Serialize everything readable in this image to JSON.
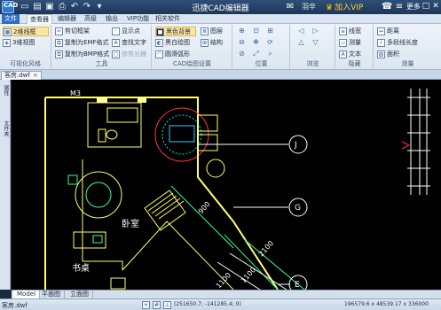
{
  "titlebar": {
    "app_icon_text": "CAD",
    "title": "迅捷CAD编辑器",
    "user_name": "羽辛",
    "vip_label": "加入VIP",
    "more_label": "更多",
    "quick_access": [
      "new-icon",
      "open-icon",
      "save-icon",
      "print-icon",
      "undo-icon",
      "redo-icon",
      "dropdown-icon"
    ]
  },
  "menubar": {
    "items": [
      "文件",
      "查看器",
      "编辑器",
      "高级",
      "输出",
      "VIP功能",
      "相关软件"
    ],
    "active_index": 1
  },
  "ribbon": {
    "visual_style": {
      "label": "可视化风格",
      "buttons": [
        "2维线框",
        "3维视图"
      ],
      "selected": 0
    },
    "tools": {
      "label": "工具",
      "buttons": [
        "剪切框架",
        "复制为EMF格式",
        "复制为BMP格式",
        "显示点",
        "查找文字",
        "修剪光栅"
      ]
    },
    "draw_settings": {
      "label": "CAD绘图设置",
      "buttons": [
        "黑色背景",
        "黑白绘图",
        "圆滑弧形",
        "图层",
        "结构"
      ],
      "selected": 0
    },
    "position": {
      "label": "位置"
    },
    "browse": {
      "label": "浏览"
    },
    "hide": {
      "label": "隐藏",
      "buttons": [
        "线宽",
        "测量",
        "文本"
      ]
    },
    "measure": {
      "label": "测量",
      "buttons": [
        "距离",
        "多段线长度",
        "面积"
      ]
    }
  },
  "document": {
    "tab_label": "客房.dwf"
  },
  "side_panel": {
    "tabs": [
      "属性",
      "文件夹"
    ]
  },
  "drawing": {
    "room_labels": [
      "M3",
      "卧室",
      "书桌"
    ],
    "grid_bubbles": [
      "J",
      "G",
      "E"
    ],
    "dimensions": [
      "900",
      "2100",
      "1100",
      "1100"
    ]
  },
  "layout_tabs": {
    "tabs": [
      "Model",
      "平面图",
      "立面图"
    ],
    "active_index": 0
  },
  "statusbar": {
    "doc_name": "客房.dwf",
    "coordinates": "(251650.7; -141285.4; 0)",
    "extents": "196579.6 x 48539.17 x 336000"
  },
  "colors": {
    "title_bg": "#1d3656",
    "ribbon_bg": "#dce6f2",
    "canvas_bg": "#000000",
    "accent": "#2c6fc4",
    "vip": "#ffcf3a"
  }
}
